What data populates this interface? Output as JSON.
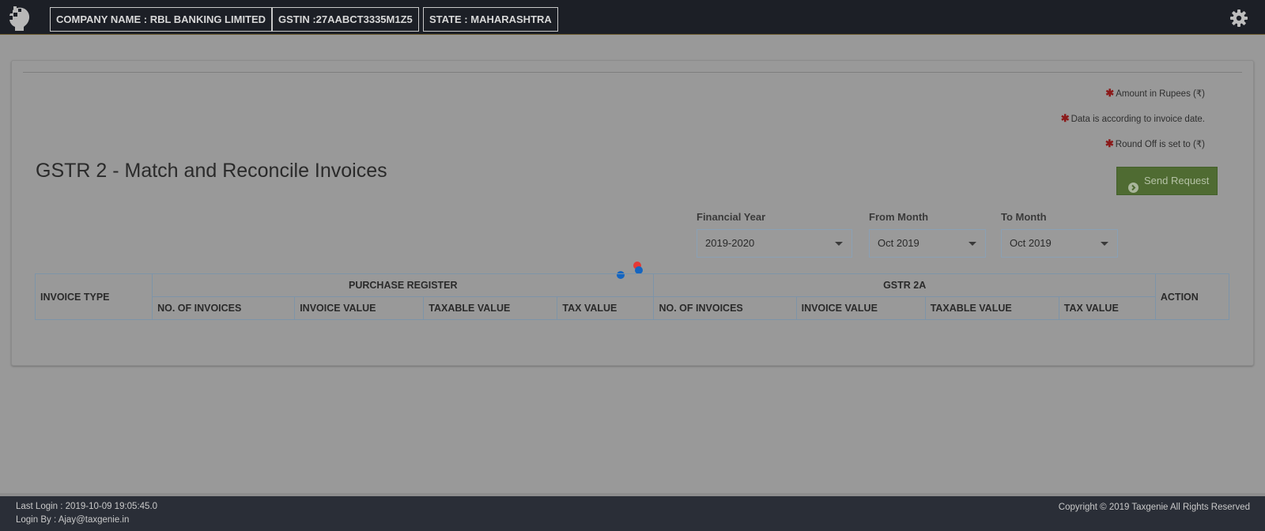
{
  "header": {
    "company_label": "COMPANY NAME : RBL BANKING LIMITED",
    "gstin_label": "GSTIN :27AABCT3335M1Z5",
    "state_label": "STATE : MAHARASHTRA",
    "logo_icon": "taxgenie-logo-icon",
    "settings_icon": "gear-icon"
  },
  "notes": {
    "amount": "Amount in Rupees (₹)",
    "data": "Data is according to invoice date.",
    "roundoff": "Round Off is set to (₹)",
    "star": "✱"
  },
  "page": {
    "title": "GSTR 2 - Match and Reconcile Invoices"
  },
  "filters": {
    "financial_year": {
      "label": "Financial Year",
      "value": "2019-2020"
    },
    "from_month": {
      "label": "From Month",
      "value": "Oct 2019"
    },
    "to_month": {
      "label": "To Month",
      "value": "Oct 2019"
    },
    "send_button": "Send Request"
  },
  "loader": {
    "colors": [
      "#1565c0",
      "#e53935",
      "#1565c0"
    ]
  },
  "table": {
    "invoice_type": "INVOICE TYPE",
    "purchase_register": "PURCHASE REGISTER",
    "gstr2a": "GSTR 2A",
    "action": "ACTION",
    "pr_columns": [
      "NO. OF INVOICES",
      "INVOICE VALUE",
      "TAXABLE VALUE",
      "TAX VALUE"
    ],
    "g2a_columns": [
      "NO. OF INVOICES",
      "INVOICE VALUE",
      "TAXABLE VALUE",
      "TAX VALUE"
    ]
  },
  "footer": {
    "last_login": "Last Login : 2019-10-09 19:05:45.0",
    "login_by": "Login By : Ajay@taxgenie.in",
    "copyright": "Copyright © 2019 Taxgenie All Rights Reserved"
  },
  "colors": {
    "header_bg": "#1c1f26",
    "send_button": "#4f6b32",
    "star": "#8b1a1a"
  }
}
